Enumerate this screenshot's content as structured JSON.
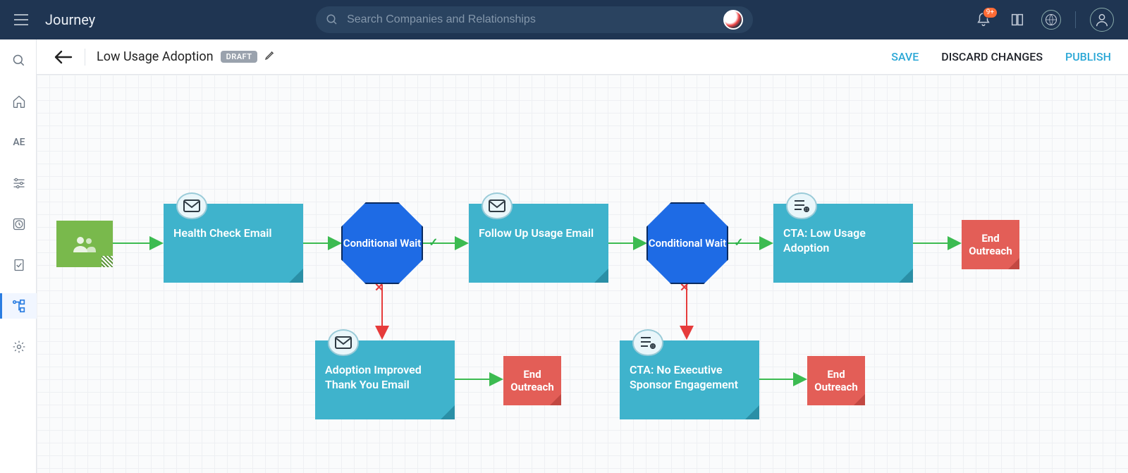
{
  "topbar": {
    "brand": "Journey",
    "search_placeholder": "Search Companies and Relationships",
    "notification_badge": "9+"
  },
  "leftnav": {
    "text_item": "AE"
  },
  "subbar": {
    "title": "Low Usage Adoption",
    "status_badge": "DRAFT",
    "save": "SAVE",
    "discard": "DISCARD CHANGES",
    "publish": "PUBLISH"
  },
  "nodes": {
    "start": "",
    "step1": "Health Check Email",
    "cond1": "Conditional Wait",
    "step2": "Follow Up Usage Email",
    "cond2": "Conditional Wait",
    "step3": "CTA: Low Usage Adoption",
    "end1": "End Outreach",
    "step4": "Adoption Improved Thank You Email",
    "end2": "End Outreach",
    "step5": "CTA: No Executive Sponsor Engagement",
    "end3": "End Outreach"
  }
}
